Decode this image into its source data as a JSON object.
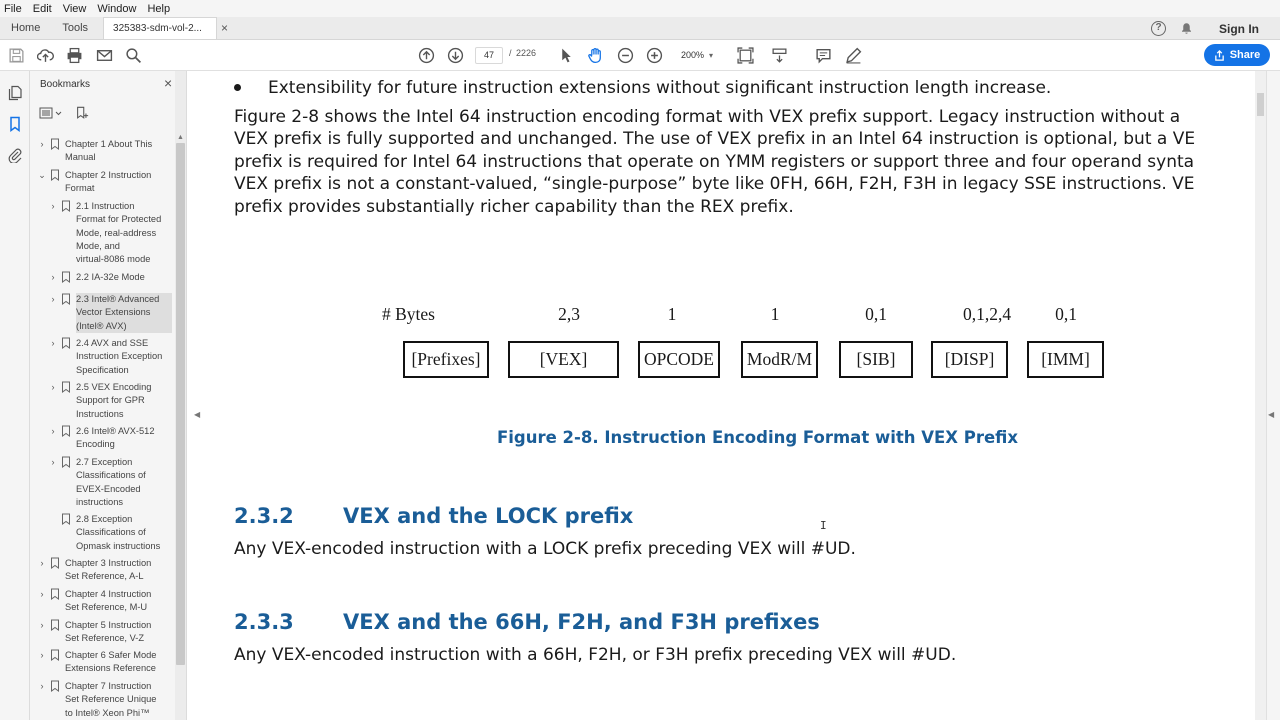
{
  "menu": [
    "File",
    "Edit",
    "View",
    "Window",
    "Help"
  ],
  "tabs": {
    "home": "Home",
    "tools": "Tools",
    "document": "325383-sdm-vol-2...",
    "close": "×"
  },
  "header_right": {
    "help": "?",
    "signin": "Sign In"
  },
  "toolbar": {
    "page_current": "47",
    "page_separator": "/",
    "page_total": "2226",
    "zoom": "200%",
    "share": "Share"
  },
  "bookmarks_panel": {
    "title": "Bookmarks",
    "close": "×",
    "items": [
      {
        "label": "Chapter 1 About This Manual",
        "lines": [
          "Chapter 1 About This",
          "Manual"
        ],
        "level": 0,
        "chevron": "›"
      },
      {
        "label": "Chapter 2 Instruction Format",
        "lines": [
          "Chapter 2 Instruction",
          "Format"
        ],
        "level": 0,
        "chevron": "⌄"
      },
      {
        "label": "2.1 Instruction Format for Protected Mode, real-address Mode, and virtual-8086 mode",
        "lines": [
          "2.1 Instruction",
          "Format for Protected",
          "Mode, real-address",
          "Mode, and",
          "virtual-8086 mode"
        ],
        "level": 1,
        "chevron": "›"
      },
      {
        "label": "2.2 IA-32e Mode",
        "lines": [
          "2.2 IA-32e Mode"
        ],
        "level": 1,
        "chevron": "›"
      },
      {
        "label": "2.3 Intel® Advanced Vector Extensions (Intel® AVX)",
        "lines": [
          "2.3 Intel® Advanced",
          "Vector Extensions",
          "(Intel® AVX)"
        ],
        "level": 1,
        "chevron": "›",
        "selected": true
      },
      {
        "label": "2.4 AVX and SSE Instruction Exception Specification",
        "lines": [
          "2.4 AVX and SSE",
          "Instruction Exception",
          "Specification"
        ],
        "level": 1,
        "chevron": "›"
      },
      {
        "label": "2.5 VEX Encoding Support for GPR Instructions",
        "lines": [
          "2.5 VEX Encoding",
          "Support for GPR",
          "Instructions"
        ],
        "level": 1,
        "chevron": "›"
      },
      {
        "label": "2.6 Intel® AVX-512 Encoding",
        "lines": [
          "2.6 Intel® AVX-512",
          "Encoding"
        ],
        "level": 1,
        "chevron": "›"
      },
      {
        "label": "2.7 Exception Classifications of EVEX-Encoded instructions",
        "lines": [
          "2.7 Exception",
          "Classifications of",
          "EVEX-Encoded",
          "instructions"
        ],
        "level": 1,
        "chevron": "›"
      },
      {
        "label": "2.8 Exception Classifications of Opmask instructions",
        "lines": [
          "2.8 Exception",
          "Classifications of",
          "Opmask instructions"
        ],
        "level": 1,
        "chevron": ""
      },
      {
        "label": "Chapter 3 Instruction Set Reference, A-L",
        "lines": [
          "Chapter 3 Instruction",
          "Set Reference, A-L"
        ],
        "level": 0,
        "chevron": "›"
      },
      {
        "label": "Chapter 4 Instruction Set Reference, M-U",
        "lines": [
          "Chapter 4 Instruction",
          "Set Reference, M-U"
        ],
        "level": 0,
        "chevron": "›"
      },
      {
        "label": "Chapter 5 Instruction Set Reference, V-Z",
        "lines": [
          "Chapter 5 Instruction",
          "Set Reference, V-Z"
        ],
        "level": 0,
        "chevron": "›"
      },
      {
        "label": "Chapter 6 Safer Mode Extensions Reference",
        "lines": [
          "Chapter 6 Safer Mode",
          "Extensions Reference"
        ],
        "level": 0,
        "chevron": "›"
      },
      {
        "label": "Chapter 7 Instruction Set Reference Unique to Intel® Xeon Phi™",
        "lines": [
          "Chapter 7 Instruction",
          "Set Reference Unique",
          "to Intel® Xeon Phi™"
        ],
        "level": 0,
        "chevron": "›"
      }
    ]
  },
  "document": {
    "bullet": "Extensibility for future instruction extensions without significant instruction length increase.",
    "paragraph_lines": [
      "Figure 2-8 shows the Intel 64 instruction encoding format with VEX prefix support. Legacy instruction without a",
      "VEX prefix is fully supported and unchanged. The use of VEX prefix in an Intel 64 instruction is optional, but a VE",
      "prefix is required for Intel 64 instructions that operate on YMM registers or support three and four operand synta",
      "VEX prefix is not a constant-valued, “single-purpose” byte like 0FH, 66H, F2H, F3H in legacy SSE instructions. VE",
      "prefix provides substantially richer capability than the REX prefix."
    ],
    "figure": {
      "bytes_label": "# Bytes",
      "fields": [
        {
          "name": "[Prefixes]",
          "bytes": ""
        },
        {
          "name": "[VEX]",
          "bytes": "2,3"
        },
        {
          "name": "OPCODE",
          "bytes": "1"
        },
        {
          "name": "ModR/M",
          "bytes": "1"
        },
        {
          "name": "[SIB]",
          "bytes": "0,1"
        },
        {
          "name": "[DISP]",
          "bytes": "0,1,2,4"
        },
        {
          "name": "[IMM]",
          "bytes": "0,1"
        }
      ],
      "caption": "Figure 2-8.  Instruction Encoding Format with VEX Prefix"
    },
    "sections": [
      {
        "number": "2.3.2",
        "title": "VEX and the LOCK prefix",
        "body": "Any VEX-encoded instruction with a LOCK prefix preceding VEX will #UD."
      },
      {
        "number": "2.3.3",
        "title": "VEX and the 66H, F2H, and F3H prefixes",
        "body": "Any VEX-encoded instruction with a 66H, F2H, or F3H prefix preceding VEX will #UD."
      }
    ],
    "cursor_glyph": "I"
  },
  "colors": {
    "heading": "#1a5d97",
    "share_button": "#1473e6"
  },
  "icons": [
    "save-icon",
    "upload-icon",
    "print-icon",
    "mail-icon",
    "search-icon",
    "arrow-up-icon",
    "arrow-down-icon",
    "pointer-icon",
    "hand-icon",
    "zoom-out-icon",
    "zoom-in-icon",
    "fit-page-icon",
    "scroll-mode-icon",
    "comment-icon",
    "pen-icon",
    "help-icon",
    "bell-icon",
    "pages-icon",
    "bookmark-icon",
    "attachment-icon"
  ]
}
